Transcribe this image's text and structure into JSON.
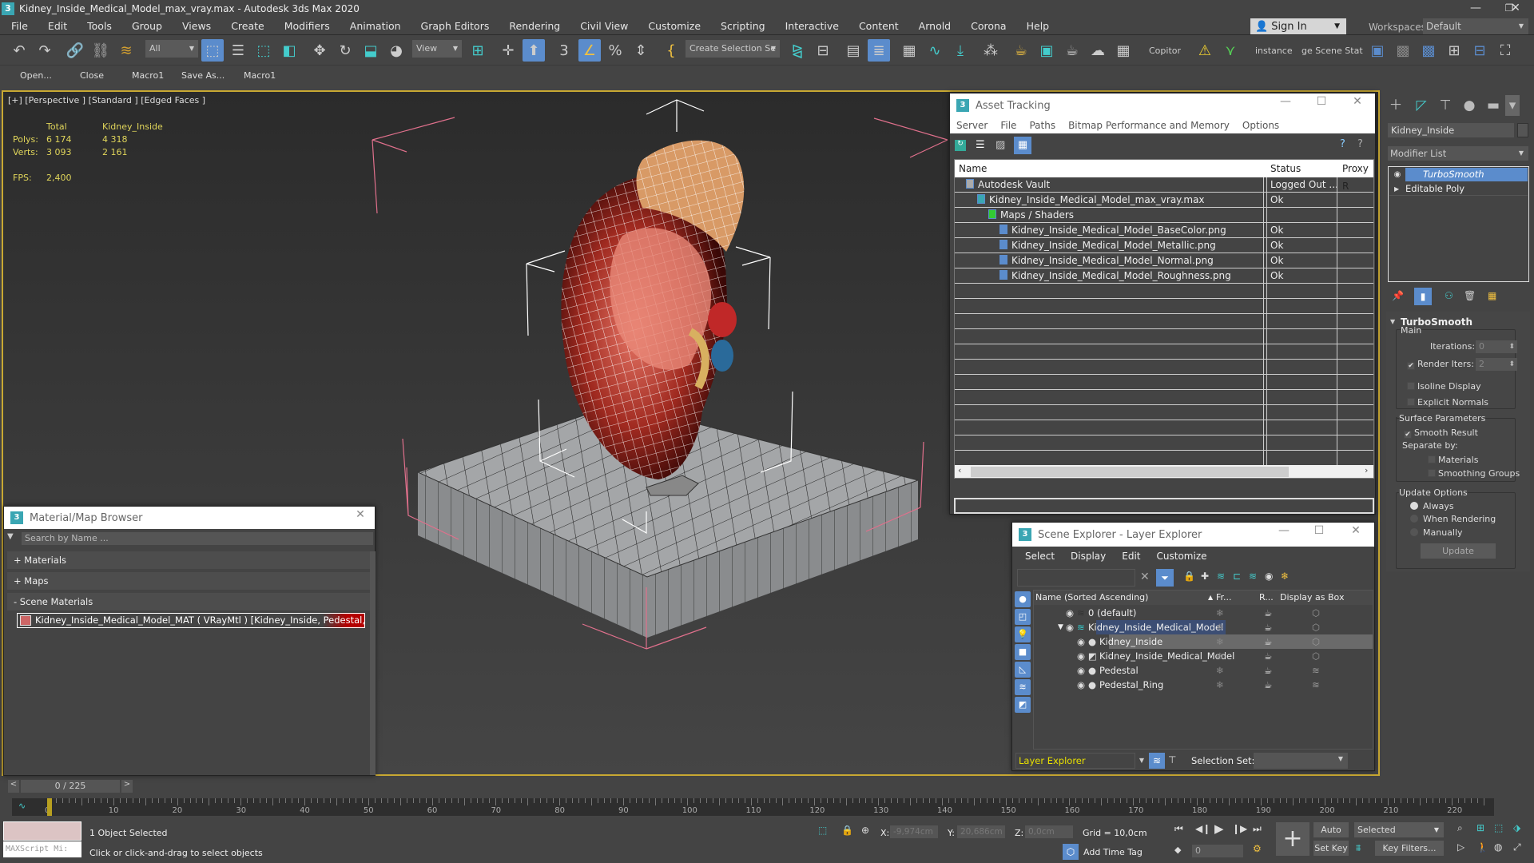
{
  "window": {
    "title": "Kidney_Inside_Medical_Model_max_vray.max - Autodesk 3ds Max 2020",
    "app_icon_text": "3",
    "controls": {
      "minimize": "—",
      "restore": "❐",
      "close": "✕"
    }
  },
  "menubar": {
    "items": [
      "File",
      "Edit",
      "Tools",
      "Group",
      "Views",
      "Create",
      "Modifiers",
      "Animation",
      "Graph Editors",
      "Rendering",
      "Civil View",
      "Customize",
      "Scripting",
      "Interactive",
      "Content",
      "Arnold",
      "Corona",
      "Help"
    ],
    "sign_in": "Sign In",
    "workspaces_label": "Workspaces:",
    "workspaces_value": "Default"
  },
  "toolbar": {
    "selection_filter": "All",
    "reference_coord": "View",
    "named_selection": "Create Selection Se",
    "copitor": "Copitor",
    "instance": "instance",
    "scene_state": "ge Scene Stat"
  },
  "macrobar": {
    "items": [
      "Open...",
      "Close",
      "Macro1",
      "Save As...",
      "Macro1"
    ]
  },
  "viewport": {
    "label": "[+] [Perspective ] [Standard ] [Edged Faces ]",
    "stats": {
      "col_total": "Total",
      "col_object": "Kidney_Inside",
      "polys_label": "Polys:",
      "polys_total": "6 174",
      "polys_object": "4 318",
      "verts_label": "Verts:",
      "verts_total": "3 093",
      "verts_object": "2 161",
      "fps_label": "FPS:",
      "fps_value": "2,400"
    }
  },
  "asset_tracking": {
    "title": "Asset Tracking",
    "menu": [
      "Server",
      "File",
      "Paths",
      "Bitmap Performance and Memory",
      "Options"
    ],
    "columns": [
      "Name",
      "Status",
      "Proxy R"
    ],
    "rows": [
      {
        "name": "Autodesk Vault",
        "status": "Logged Out ...",
        "indent": 1,
        "icon": "vault-icon"
      },
      {
        "name": "Kidney_Inside_Medical_Model_max_vray.max",
        "status": "Ok",
        "indent": 2,
        "icon": "max-file-icon"
      },
      {
        "name": "Maps / Shaders",
        "status": "",
        "indent": 3,
        "icon": "maps-folder-icon"
      },
      {
        "name": "Kidney_Inside_Medical_Model_BaseColor.png",
        "status": "Ok",
        "indent": 4,
        "icon": "image-file-icon"
      },
      {
        "name": "Kidney_Inside_Medical_Model_Metallic.png",
        "status": "Ok",
        "indent": 4,
        "icon": "image-file-icon"
      },
      {
        "name": "Kidney_Inside_Medical_Model_Normal.png",
        "status": "Ok",
        "indent": 4,
        "icon": "image-file-icon"
      },
      {
        "name": "Kidney_Inside_Medical_Model_Roughness.png",
        "status": "Ok",
        "indent": 4,
        "icon": "image-file-icon"
      }
    ]
  },
  "material_browser": {
    "title": "Material/Map Browser",
    "search_placeholder": "Search by Name ...",
    "sections": [
      "+ Materials",
      "+ Maps",
      "- Scene Materials"
    ],
    "scene_material": "Kidney_Inside_Medical_Model_MAT ( VRayMtl ) [Kidney_Inside, Pedestal, Ped..."
  },
  "scene_explorer": {
    "title": "Scene Explorer - Layer Explorer",
    "menu": [
      "Select",
      "Display",
      "Edit",
      "Customize"
    ],
    "columns": [
      "Name (Sorted Ascending)",
      "Fr...",
      "R...",
      "Display as Box"
    ],
    "rows": [
      {
        "name": "0 (default)",
        "level": 0,
        "type": "layer",
        "selected": false
      },
      {
        "name": "Kidney_Inside_Medical_Model",
        "level": 0,
        "type": "layer-active",
        "selected": true
      },
      {
        "name": "Kidney_Inside",
        "level": 1,
        "type": "object",
        "selected": true
      },
      {
        "name": "Kidney_Inside_Medical_Model",
        "level": 1,
        "type": "group",
        "selected": false
      },
      {
        "name": "Pedestal",
        "level": 1,
        "type": "object",
        "selected": false
      },
      {
        "name": "Pedestal_Ring",
        "level": 1,
        "type": "object",
        "selected": false
      }
    ],
    "explorer_type": "Layer Explorer",
    "selection_set_label": "Selection Set:",
    "selection_set_value": ""
  },
  "command_panel": {
    "object_name": "Kidney_Inside",
    "modifier_list": "Modifier List",
    "stack": [
      "TurboSmooth",
      "Editable Poly"
    ],
    "turbosmooth": {
      "title": "TurboSmooth",
      "main_label": "Main",
      "iterations_label": "Iterations:",
      "iterations": "0",
      "render_iters_label": "Render Iters:",
      "render_iters": "2",
      "render_iters_checked": true,
      "isoline_display": "Isoline Display",
      "isoline_checked": false,
      "explicit_normals": "Explicit Normals",
      "explicit_checked": false,
      "surface_params_label": "Surface Parameters",
      "smooth_result": "Smooth Result",
      "smooth_checked": true,
      "separate_by": "Separate by:",
      "materials": "Materials",
      "smoothing_groups": "Smoothing Groups",
      "update_options_label": "Update Options",
      "update_options": [
        "Always",
        "When Rendering",
        "Manually"
      ],
      "update_selected": "Always",
      "update_button": "Update"
    }
  },
  "timeline": {
    "frame_display": "0 / 225",
    "current_frame": 0,
    "total_frames": 225,
    "tick_labels": [
      "0",
      "10",
      "20",
      "30",
      "40",
      "50",
      "60",
      "70",
      "80",
      "90",
      "100",
      "110",
      "120",
      "130",
      "140",
      "150",
      "160",
      "170",
      "180",
      "190",
      "200",
      "210",
      "220"
    ]
  },
  "statusbar": {
    "maxscript_placeholder": "MAXScript Mi:",
    "selection_info": "1 Object Selected",
    "prompt": "Click or click-and-drag to select objects",
    "x_label": "X:",
    "x_value": "-9,974cm",
    "y_label": "Y:",
    "y_value": "20,686cm",
    "z_label": "Z:",
    "z_value": "0,0cm",
    "grid": "Grid = 10,0cm",
    "add_time_tag": "Add Time Tag",
    "auto_key": "Auto Key",
    "set_key": "Set Key",
    "key_mode": "Selected",
    "key_filters": "Key Filters...",
    "frame_spinner": "0"
  },
  "colors": {
    "accent_blue": "#5b8ccc",
    "viewport_border": "#c8a832",
    "stats_text": "#e0d55a",
    "explorer_text": "#e8e000",
    "selection_red": "#b40000"
  }
}
